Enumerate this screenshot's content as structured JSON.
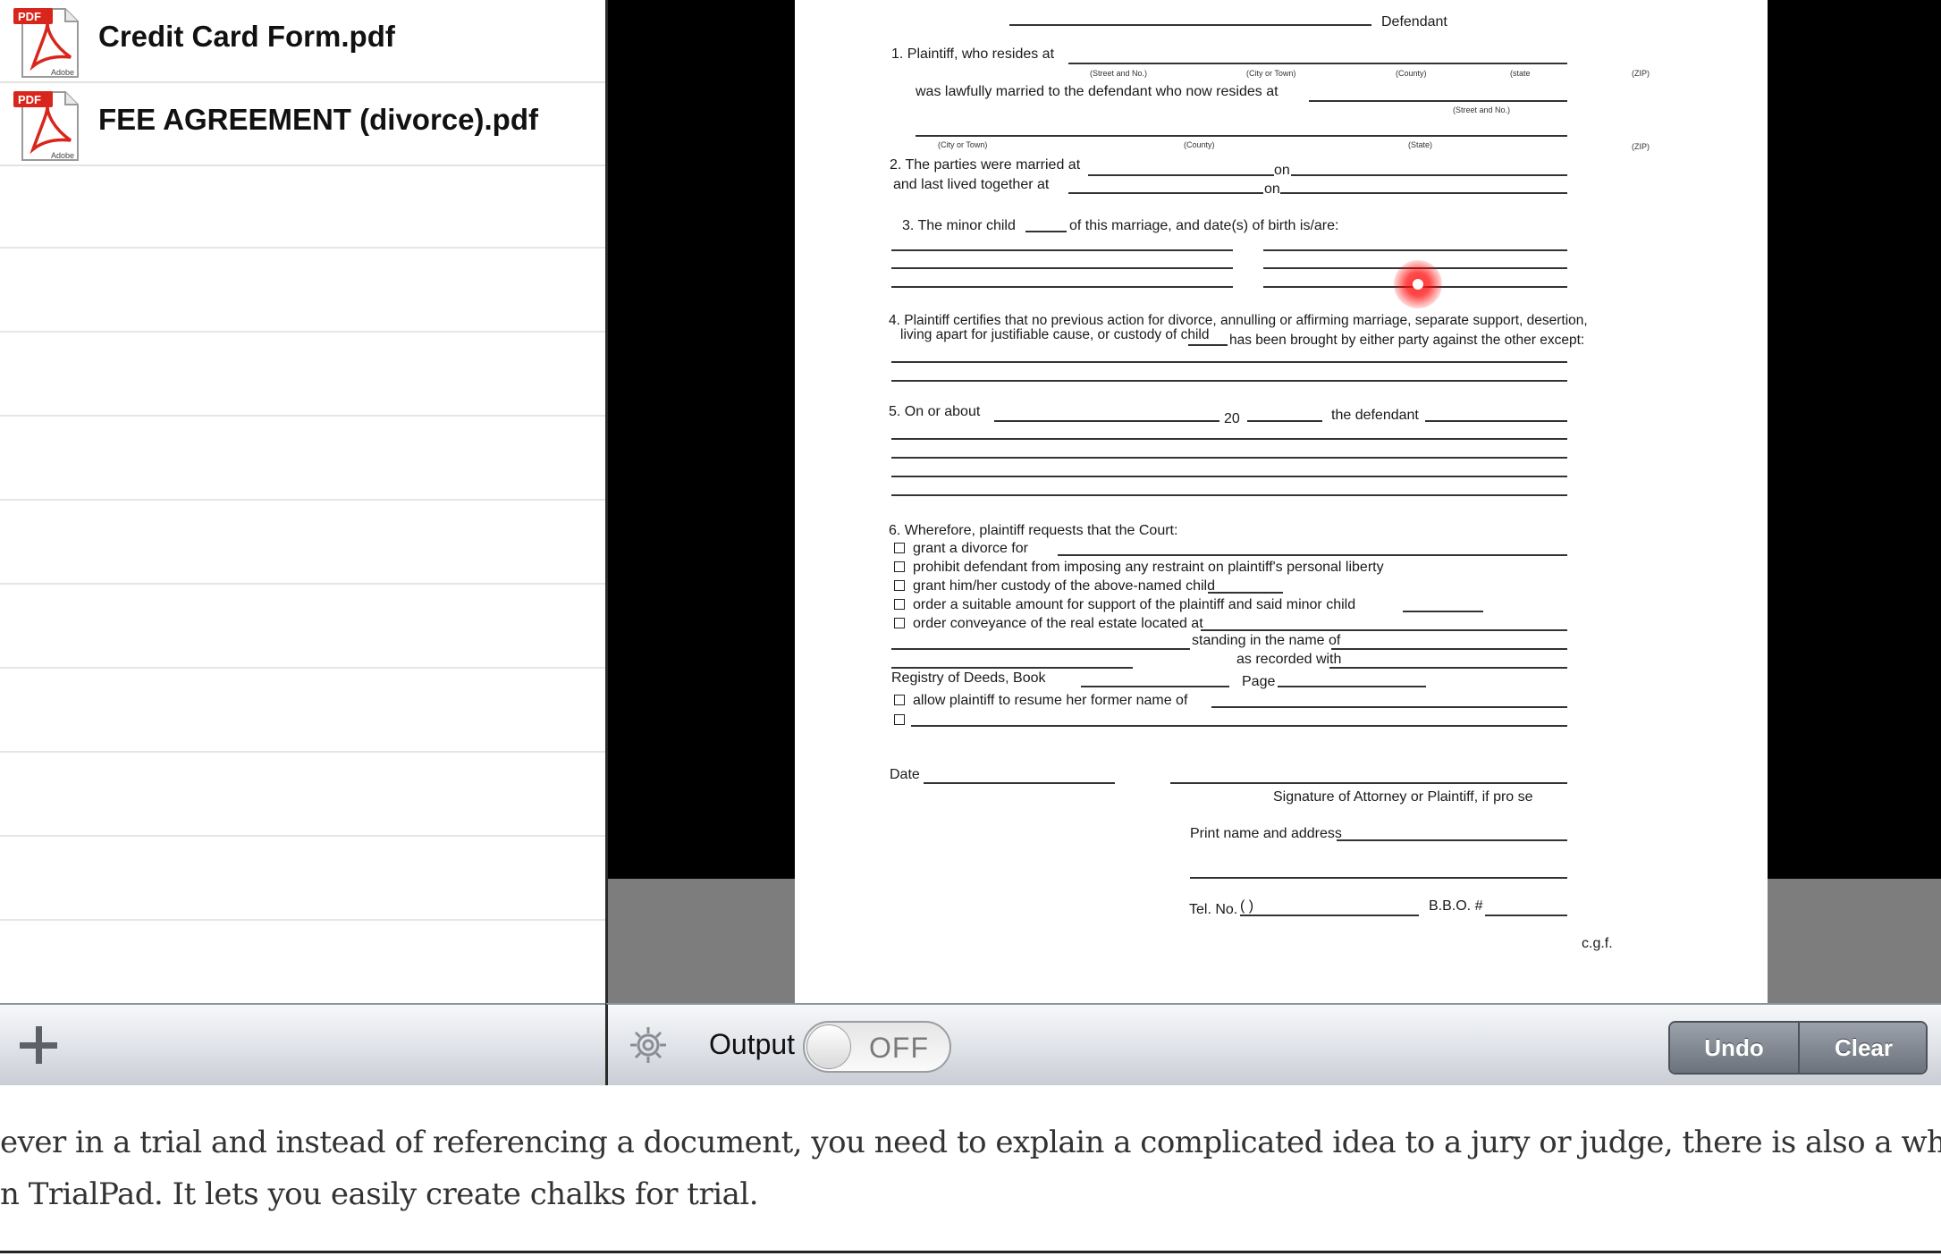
{
  "file_list": {
    "files": [
      {
        "name": "Credit Card Form.pdf",
        "icon": "pdf-file-icon",
        "badge": "PDF",
        "badge_sub": "Adobe"
      },
      {
        "name": "FEE AGREEMENT (divorce).pdf",
        "icon": "pdf-file-icon",
        "badge": "PDF",
        "badge_sub": "Adobe"
      }
    ],
    "add_icon": "plus-icon"
  },
  "document": {
    "defendant_label": "Defendant",
    "p1_text": "1. Plaintiff, who resides at",
    "p1_sub": [
      "(Street and No.)",
      "(City or Town)",
      "(County)",
      "(state",
      "(ZIP)"
    ],
    "p1_line2": "was lawfully married to the defendant who now resides at",
    "p1_sub2": "(Street and No.)",
    "p1_sub3": [
      "(City or Town)",
      "(County)",
      "(State)",
      "(ZIP)"
    ],
    "p2_text": "2. The parties were married at",
    "p2_on": "on",
    "p2_line2": "and last lived together at",
    "p2_on2": "on",
    "p3_text": "3. The minor child",
    "p3_rest": "of this marriage, and date(s) of birth is/are:",
    "p4_text": "4. Plaintiff certifies that no previous action for divorce, annulling or affirming marriage, separate support, desertion,",
    "p4_line2": "living apart for justifiable cause, or custody of child",
    "p4_rest": "has been brought by either party against the other except:",
    "p5_text": "5. On or about",
    "p5_20": "20",
    "p5_def": "the defendant",
    "p6_text": "6. Wherefore, plaintiff requests that the Court:",
    "p6_items": [
      "grant a divorce for",
      "prohibit defendant from imposing any restraint on plaintiff's personal liberty",
      "grant him/her custody of the above-named child",
      "order a suitable amount for support of the plaintiff and said minor child",
      "order conveyance of the real estate located at"
    ],
    "standing": "standing in the name of",
    "recorded": "as recorded with",
    "registry": "Registry of Deeds, Book",
    "page": "Page",
    "allow": "allow plaintiff to resume her former name of",
    "date_label": "Date",
    "signature_label": "Signature of Attorney or Plaintiff, if pro se",
    "print_label": "Print name and address",
    "tel_label": "Tel. No.",
    "tel_parens": "(         )",
    "bbo_label": "B.B.O. #",
    "footer": "c.g.f."
  },
  "toolbar": {
    "gear_icon": "gear-icon",
    "output_label": "Output",
    "output_state": "OFF",
    "undo_label": "Undo",
    "clear_label": "Clear"
  },
  "caption": {
    "line1": " ever in a trial and instead of referencing a document, you need to explain a complicated idea to a jury or judge, there is also a whiteb",
    "line2": "n TrialPad.  It lets you easily create chalks for trial."
  }
}
